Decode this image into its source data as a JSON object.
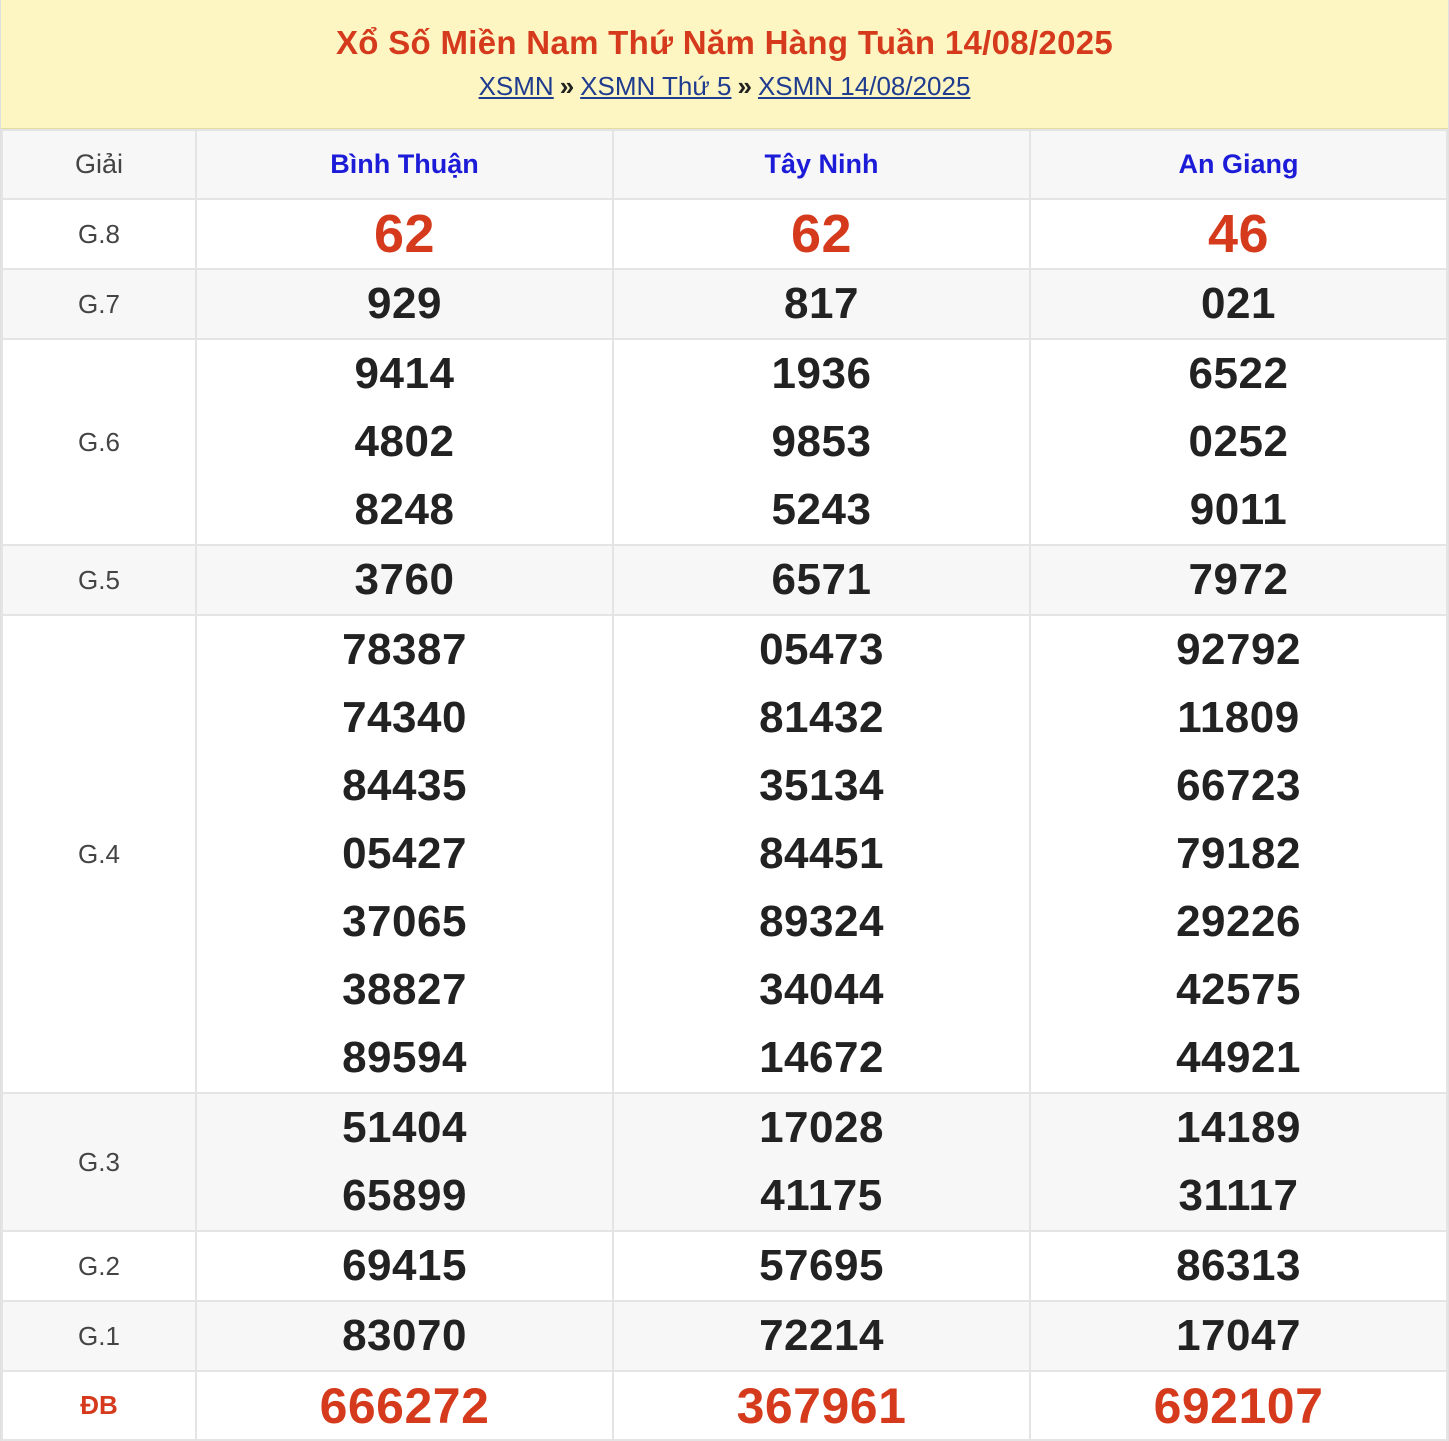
{
  "header": {
    "title": "Xổ Số Miền Nam Thứ Năm Hàng Tuần 14/08/2025",
    "breadcrumb": [
      "XSMN",
      "XSMN Thứ 5",
      "XSMN 14/08/2025"
    ],
    "separator": "»"
  },
  "table": {
    "giai_header": "Giải",
    "provinces": [
      "Bình Thuận",
      "Tây Ninh",
      "An Giang"
    ],
    "rows": [
      {
        "label": "G.8",
        "values": [
          [
            "62"
          ],
          [
            "62"
          ],
          [
            "46"
          ]
        ]
      },
      {
        "label": "G.7",
        "values": [
          [
            "929"
          ],
          [
            "817"
          ],
          [
            "021"
          ]
        ]
      },
      {
        "label": "G.6",
        "values": [
          [
            "9414",
            "4802",
            "8248"
          ],
          [
            "1936",
            "9853",
            "5243"
          ],
          [
            "6522",
            "0252",
            "9011"
          ]
        ]
      },
      {
        "label": "G.5",
        "values": [
          [
            "3760"
          ],
          [
            "6571"
          ],
          [
            "7972"
          ]
        ]
      },
      {
        "label": "G.4",
        "values": [
          [
            "78387",
            "74340",
            "84435",
            "05427",
            "37065",
            "38827",
            "89594"
          ],
          [
            "05473",
            "81432",
            "35134",
            "84451",
            "89324",
            "34044",
            "14672"
          ],
          [
            "92792",
            "11809",
            "66723",
            "79182",
            "29226",
            "42575",
            "44921"
          ]
        ]
      },
      {
        "label": "G.3",
        "values": [
          [
            "51404",
            "65899"
          ],
          [
            "17028",
            "41175"
          ],
          [
            "14189",
            "31117"
          ]
        ]
      },
      {
        "label": "G.2",
        "values": [
          [
            "69415"
          ],
          [
            "57695"
          ],
          [
            "86313"
          ]
        ]
      },
      {
        "label": "G.1",
        "values": [
          [
            "83070"
          ],
          [
            "72214"
          ],
          [
            "17047"
          ]
        ]
      },
      {
        "label": "ĐB",
        "values": [
          [
            "666272"
          ],
          [
            "367961"
          ],
          [
            "692107"
          ]
        ]
      }
    ]
  },
  "colors": {
    "accent_red": "#d53a1d",
    "province_blue": "#1b1bd8",
    "header_bg": "#fdf5c2",
    "link": "#1f3c8f"
  }
}
